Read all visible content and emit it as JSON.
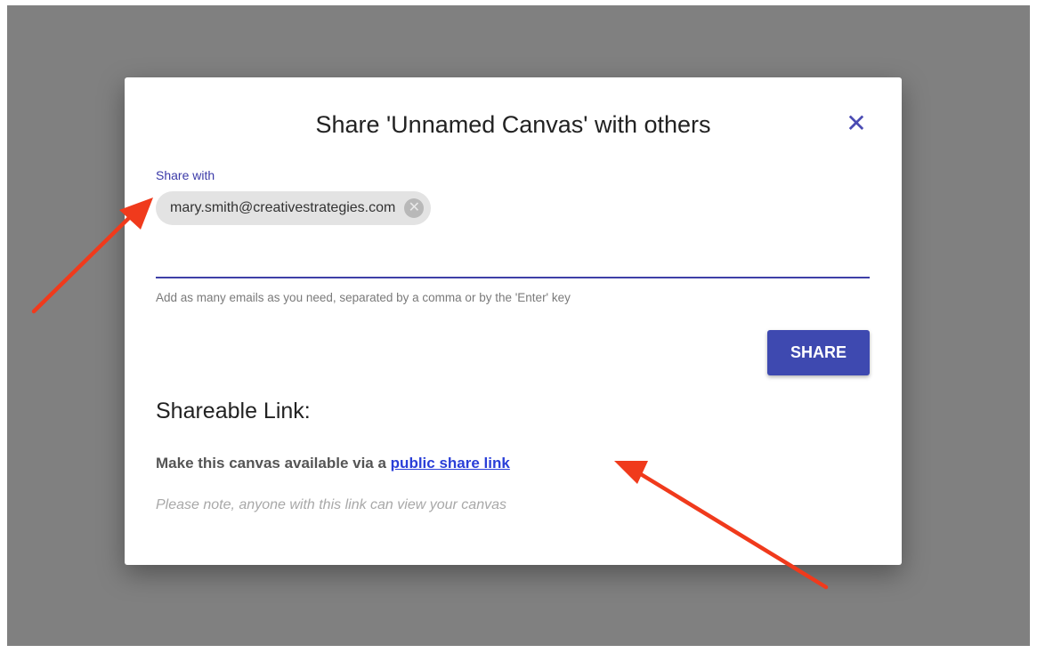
{
  "dialog": {
    "title": "Share 'Unnamed Canvas' with others",
    "close_icon": "close-icon",
    "share_with_label": "Share with",
    "chips": [
      {
        "email": "mary.smith@creativestrategies.com"
      }
    ],
    "helper_text": "Add as many emails as you need, separated by a comma or by the 'Enter' key",
    "share_button_label": "SHARE",
    "shareable_title": "Shareable Link:",
    "link_prefix": "Make this canvas available via a",
    "link_text": "public share link",
    "note": "Please note, anyone with this link can view your canvas"
  },
  "colors": {
    "accent": "#3e49b0",
    "link": "#2a3fd8",
    "annotation_arrow": "#f03a1c",
    "backdrop": "#808080"
  }
}
